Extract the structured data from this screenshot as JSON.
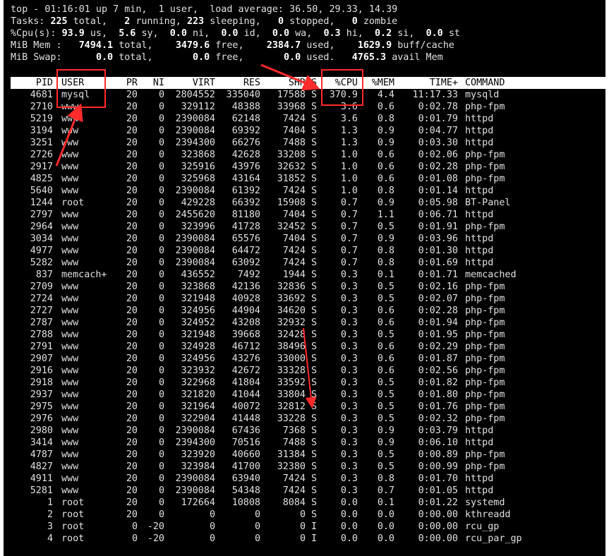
{
  "summary": {
    "line1": "top - 01:16:01 up 7 min,  1 user,  load average: 36.50, 29.33, 14.39",
    "tasks": {
      "label": "Tasks:",
      "total": "225",
      "total_label": "total,",
      "running": "2",
      "running_label": "running,",
      "sleeping": "223",
      "sleeping_label": "sleeping,",
      "stopped": "0",
      "stopped_label": "stopped,",
      "zombie": "0",
      "zombie_label": "zombie"
    },
    "cpu": {
      "label": "%Cpu(s):",
      "us": "93.9",
      "us_label": "us,",
      "sy": "5.6",
      "sy_label": "sy,",
      "ni": "0.0",
      "ni_label": "ni,",
      "id": "0.0",
      "id_label": "id,",
      "wa": "0.0",
      "wa_label": "wa,",
      "hi": "0.3",
      "hi_label": "hi,",
      "si": "0.2",
      "si_label": "si,",
      "st": "0.0",
      "st_label": "st"
    },
    "mem": {
      "label": "MiB Mem :",
      "total": "7494.1",
      "total_label": "total,",
      "free": "3479.6",
      "free_label": "free,",
      "used": "2384.7",
      "used_label": "used,",
      "buff": "1629.9",
      "buff_label": "buff/cache"
    },
    "swap": {
      "label": "MiB Swap:",
      "total": "0.0",
      "total_label": "total,",
      "free": "0.0",
      "free_label": "free,",
      "used": "0.0",
      "used_label": "used.",
      "avail": "4765.3",
      "avail_label": "avail Mem"
    }
  },
  "columns": [
    "PID",
    "USER",
    "PR",
    "NI",
    "VIRT",
    "RES",
    "SHR",
    "S",
    "%CPU",
    "%MEM",
    "TIME+",
    "COMMAND"
  ],
  "processes": [
    [
      "4681",
      "mysql",
      "20",
      "0",
      "2804552",
      "335040",
      "17588",
      "S",
      "370.9",
      "4.4",
      "11:17.33",
      "mysqld"
    ],
    [
      "2710",
      "www",
      "20",
      "0",
      "329112",
      "48388",
      "33968",
      "S",
      "3.6",
      "0.6",
      "0:02.78",
      "php-fpm"
    ],
    [
      "5219",
      "www",
      "20",
      "0",
      "2390084",
      "62148",
      "7424",
      "S",
      "3.6",
      "0.8",
      "0:01.79",
      "httpd"
    ],
    [
      "3194",
      "www",
      "20",
      "0",
      "2390084",
      "69392",
      "7404",
      "S",
      "1.3",
      "0.9",
      "0:04.77",
      "httpd"
    ],
    [
      "3251",
      "www",
      "20",
      "0",
      "2394300",
      "66276",
      "7488",
      "S",
      "1.3",
      "0.9",
      "0:03.30",
      "httpd"
    ],
    [
      "2726",
      "www",
      "20",
      "0",
      "323868",
      "42628",
      "33208",
      "S",
      "1.0",
      "0.6",
      "0:02.06",
      "php-fpm"
    ],
    [
      "2917",
      "www",
      "20",
      "0",
      "325916",
      "43976",
      "32632",
      "S",
      "1.0",
      "0.6",
      "0:02.28",
      "php-fpm"
    ],
    [
      "4825",
      "www",
      "20",
      "0",
      "325968",
      "43164",
      "31852",
      "S",
      "1.0",
      "0.6",
      "0:01.08",
      "php-fpm"
    ],
    [
      "5640",
      "www",
      "20",
      "0",
      "2390084",
      "61392",
      "7424",
      "S",
      "1.0",
      "0.8",
      "0:01.14",
      "httpd"
    ],
    [
      "1244",
      "root",
      "20",
      "0",
      "429228",
      "66392",
      "15908",
      "S",
      "0.7",
      "0.9",
      "0:05.98",
      "BT-Panel"
    ],
    [
      "2797",
      "www",
      "20",
      "0",
      "2455620",
      "81180",
      "7404",
      "S",
      "0.7",
      "1.1",
      "0:06.71",
      "httpd"
    ],
    [
      "2964",
      "www",
      "20",
      "0",
      "323996",
      "41728",
      "32452",
      "S",
      "0.7",
      "0.5",
      "0:01.91",
      "php-fpm"
    ],
    [
      "3034",
      "www",
      "20",
      "0",
      "2390084",
      "65576",
      "7404",
      "S",
      "0.7",
      "0.9",
      "0:03.96",
      "httpd"
    ],
    [
      "4977",
      "www",
      "20",
      "0",
      "2390084",
      "64472",
      "7424",
      "S",
      "0.7",
      "0.8",
      "0:01.30",
      "httpd"
    ],
    [
      "5282",
      "www",
      "20",
      "0",
      "2390084",
      "63092",
      "7424",
      "S",
      "0.7",
      "0.8",
      "0:01.69",
      "httpd"
    ],
    [
      "837",
      "memcach+",
      "20",
      "0",
      "436552",
      "7492",
      "1944",
      "S",
      "0.3",
      "0.1",
      "0:01.71",
      "memcached"
    ],
    [
      "2709",
      "www",
      "20",
      "0",
      "323868",
      "42136",
      "32836",
      "S",
      "0.3",
      "0.5",
      "0:02.16",
      "php-fpm"
    ],
    [
      "2724",
      "www",
      "20",
      "0",
      "321948",
      "40928",
      "33692",
      "S",
      "0.3",
      "0.5",
      "0:02.07",
      "php-fpm"
    ],
    [
      "2727",
      "www",
      "20",
      "0",
      "324956",
      "44904",
      "34620",
      "S",
      "0.3",
      "0.6",
      "0:02.28",
      "php-fpm"
    ],
    [
      "2787",
      "www",
      "20",
      "0",
      "324952",
      "43208",
      "32932",
      "S",
      "0.3",
      "0.6",
      "0:01.94",
      "php-fpm"
    ],
    [
      "2788",
      "www",
      "20",
      "0",
      "321948",
      "39668",
      "32428",
      "S",
      "0.3",
      "0.5",
      "0:01.95",
      "php-fpm"
    ],
    [
      "2791",
      "www",
      "20",
      "0",
      "324928",
      "46712",
      "38496",
      "S",
      "0.3",
      "0.6",
      "0:02.29",
      "php-fpm"
    ],
    [
      "2907",
      "www",
      "20",
      "0",
      "324956",
      "43276",
      "33000",
      "S",
      "0.3",
      "0.6",
      "0:01.87",
      "php-fpm"
    ],
    [
      "2916",
      "www",
      "20",
      "0",
      "323932",
      "42672",
      "33328",
      "S",
      "0.3",
      "0.6",
      "0:02.56",
      "php-fpm"
    ],
    [
      "2918",
      "www",
      "20",
      "0",
      "322968",
      "41804",
      "33592",
      "S",
      "0.3",
      "0.5",
      "0:01.82",
      "php-fpm"
    ],
    [
      "2937",
      "www",
      "20",
      "0",
      "321820",
      "41044",
      "33804",
      "S",
      "0.3",
      "0.5",
      "0:01.80",
      "php-fpm"
    ],
    [
      "2975",
      "www",
      "20",
      "0",
      "321964",
      "40072",
      "32812",
      "S",
      "0.3",
      "0.5",
      "0:01.76",
      "php-fpm"
    ],
    [
      "2976",
      "www",
      "20",
      "0",
      "322904",
      "41448",
      "33228",
      "S",
      "0.3",
      "0.5",
      "0:02.32",
      "php-fpm"
    ],
    [
      "2980",
      "www",
      "20",
      "0",
      "2390084",
      "67436",
      "7368",
      "S",
      "0.3",
      "0.9",
      "0:03.79",
      "httpd"
    ],
    [
      "3414",
      "www",
      "20",
      "0",
      "2394300",
      "70516",
      "7488",
      "S",
      "0.3",
      "0.9",
      "0:06.10",
      "httpd"
    ],
    [
      "4787",
      "www",
      "20",
      "0",
      "323920",
      "40660",
      "31384",
      "S",
      "0.3",
      "0.5",
      "0:00.89",
      "php-fpm"
    ],
    [
      "4827",
      "www",
      "20",
      "0",
      "323984",
      "41700",
      "32380",
      "S",
      "0.3",
      "0.5",
      "0:00.99",
      "php-fpm"
    ],
    [
      "4911",
      "www",
      "20",
      "0",
      "2390084",
      "63940",
      "7424",
      "S",
      "0.3",
      "0.8",
      "0:01.70",
      "httpd"
    ],
    [
      "5281",
      "www",
      "20",
      "0",
      "2390084",
      "54348",
      "7424",
      "S",
      "0.3",
      "0.7",
      "0:01.05",
      "httpd"
    ],
    [
      "1",
      "root",
      "20",
      "0",
      "172664",
      "10808",
      "8084",
      "S",
      "0.0",
      "0.1",
      "0:01.22",
      "systemd"
    ],
    [
      "2",
      "root",
      "20",
      "0",
      "0",
      "0",
      "0",
      "S",
      "0.0",
      "0.0",
      "0:00.00",
      "kthreadd"
    ],
    [
      "3",
      "root",
      "0",
      "-20",
      "0",
      "0",
      "0",
      "I",
      "0.0",
      "0.0",
      "0:00.00",
      "rcu_gp"
    ],
    [
      "4",
      "root",
      "0",
      "-20",
      "0",
      "0",
      "0",
      "I",
      "0.0",
      "0.0",
      "0:00.00",
      "rcu_par_gp"
    ]
  ],
  "colors": {
    "terminal_bg": "#000000",
    "terminal_fg": "#e0e0e0",
    "header_bg": "#ffffff",
    "annotation": "#ff2a2a"
  }
}
